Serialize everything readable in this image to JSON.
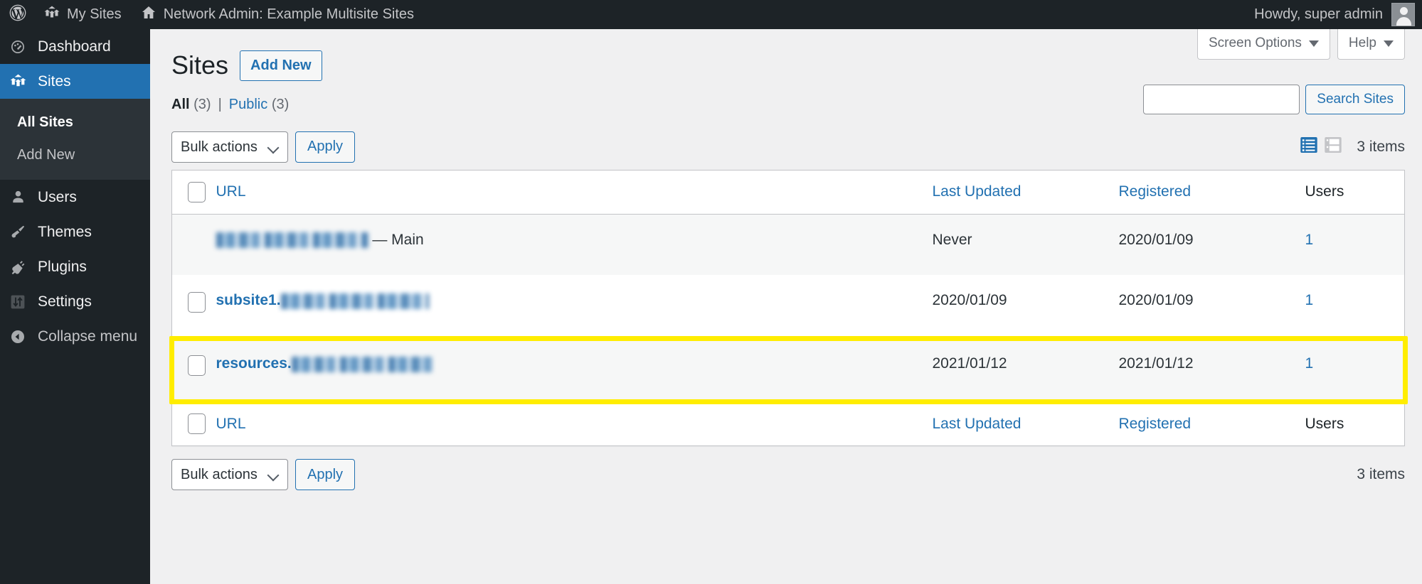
{
  "adminbar": {
    "logo_icon": "wordpress-logo-icon",
    "my_sites": {
      "label": "My Sites",
      "icon": "multisite-icon"
    },
    "network_admin": {
      "label": "Network Admin: Example Multisite Sites",
      "icon": "home-icon"
    },
    "howdy": "Howdy, super admin",
    "avatar_icon": "user-avatar-icon"
  },
  "sidebar": {
    "items": [
      {
        "label": "Dashboard",
        "icon": "dashboard-icon",
        "current": false
      },
      {
        "label": "Sites",
        "icon": "multisite-icon",
        "current": true
      },
      {
        "label": "Users",
        "icon": "user-icon",
        "current": false
      },
      {
        "label": "Themes",
        "icon": "brush-icon",
        "current": false
      },
      {
        "label": "Plugins",
        "icon": "plug-icon",
        "current": false
      },
      {
        "label": "Settings",
        "icon": "sliders-icon",
        "current": false
      }
    ],
    "submenu": [
      {
        "label": "All Sites",
        "current": true
      },
      {
        "label": "Add New",
        "current": false
      }
    ],
    "collapse": {
      "label": "Collapse menu",
      "icon": "collapse-arrow-icon"
    }
  },
  "screen_meta": {
    "screen_options": "Screen Options",
    "help": "Help"
  },
  "header": {
    "title": "Sites",
    "add_new": "Add New"
  },
  "filters": [
    {
      "label": "All",
      "count": "(3)",
      "current": true
    },
    {
      "label": "Public",
      "count": "(3)",
      "current": false
    }
  ],
  "filters_separator": "|",
  "search": {
    "value": "",
    "placeholder": "",
    "button": "Search Sites"
  },
  "tablenav_top": {
    "bulk_label": "Bulk actions",
    "apply": "Apply",
    "items_count": "3 items",
    "view_list_icon": "list-view-icon",
    "view_excerpt_icon": "excerpt-view-icon"
  },
  "tablenav_bottom": {
    "bulk_label": "Bulk actions",
    "apply": "Apply",
    "items_count": "3 items"
  },
  "table": {
    "columns": {
      "url": "URL",
      "last_updated": "Last Updated",
      "registered": "Registered",
      "users": "Users"
    },
    "rows": [
      {
        "url_prefix": "",
        "url_redacted": true,
        "suffix": "— Main",
        "last_updated": "Never",
        "registered": "2020/01/09",
        "users": "1",
        "has_checkbox": false,
        "highlighted": false
      },
      {
        "url_prefix": "subsite1.",
        "url_redacted": true,
        "suffix": "",
        "last_updated": "2020/01/09",
        "registered": "2020/01/09",
        "users": "1",
        "has_checkbox": true,
        "highlighted": false
      },
      {
        "url_prefix": "resources.",
        "url_redacted": true,
        "suffix": "",
        "last_updated": "2021/01/12",
        "registered": "2021/01/12",
        "users": "1",
        "has_checkbox": true,
        "highlighted": true
      }
    ]
  },
  "colors": {
    "admin_bar_bg": "#1d2327",
    "sidebar_bg": "#1d2327",
    "submenu_bg": "#2c3338",
    "accent_blue": "#2271b1",
    "current_menu_bg": "#2271b1",
    "content_bg": "#f0f0f1",
    "highlight_yellow": "#ffed00",
    "link_blue": "#2271b1"
  }
}
